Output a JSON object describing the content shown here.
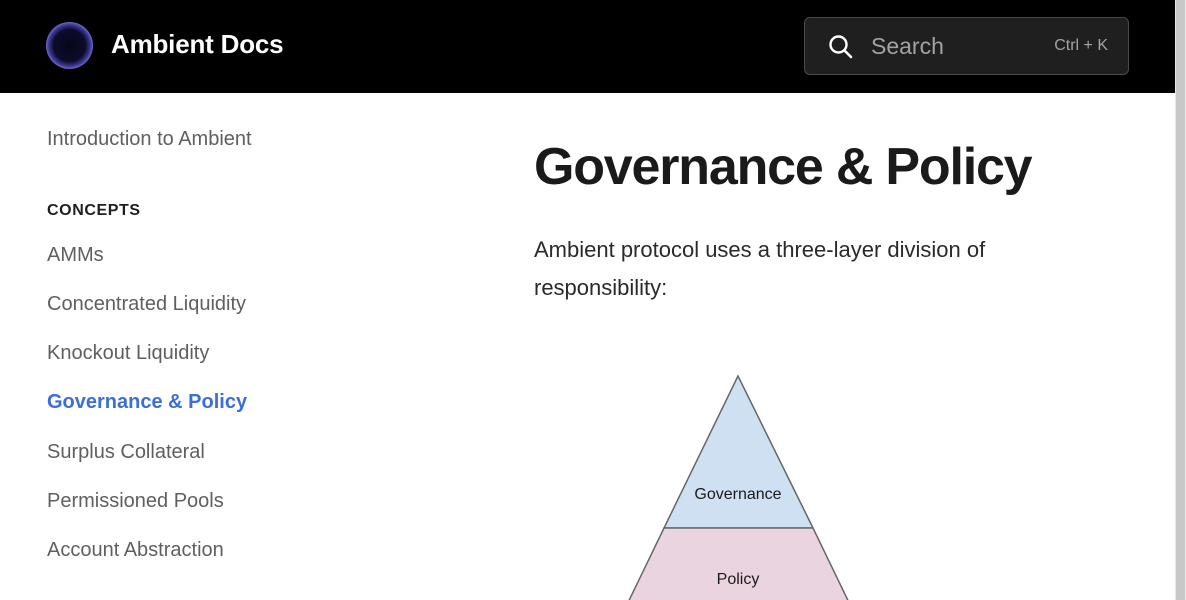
{
  "header": {
    "brand": "Ambient Docs",
    "search_placeholder": "Search",
    "search_shortcut": "Ctrl + K"
  },
  "sidebar": {
    "intro_link": "Introduction to Ambient",
    "section_title": "CONCEPTS",
    "items": [
      {
        "label": "AMMs"
      },
      {
        "label": "Concentrated Liquidity"
      },
      {
        "label": "Knockout Liquidity"
      },
      {
        "label": "Governance & Policy",
        "active": true
      },
      {
        "label": "Surplus Collateral"
      },
      {
        "label": "Permissioned Pools"
      },
      {
        "label": "Account Abstraction"
      }
    ]
  },
  "main": {
    "title": "Governance & Policy",
    "intro": "Ambient protocol uses a three-layer division of responsibility:",
    "diagram": {
      "layers": [
        {
          "label": "Governance",
          "color": "#cfe0f2"
        },
        {
          "label": "Policy",
          "color": "#ead4df"
        }
      ]
    }
  },
  "colors": {
    "header_bg": "#000000",
    "accent": "#3b6fd4"
  }
}
